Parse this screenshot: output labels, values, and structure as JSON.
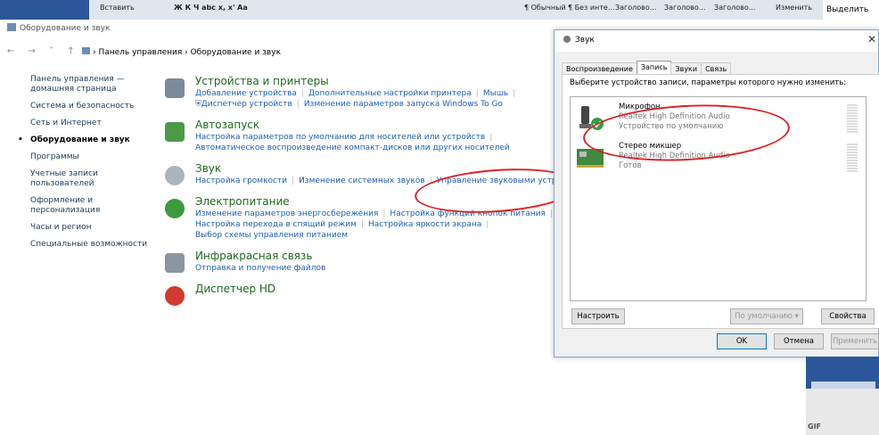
{
  "ribbon": {
    "insert": "Вставить",
    "format": "Ж  К  Ч  abc  x,  x'  Aa",
    "styles": [
      "¶ Обычный",
      "¶ Без инте...",
      "Заголово...",
      "Заголово...",
      "Заголово..."
    ],
    "change": "Изменить",
    "select": "Выделить"
  },
  "control_panel": {
    "window_title": "Оборудование и звук",
    "address": {
      "nav": "←  →  ˅  ↑",
      "breadcrumb": "›  Панель управления  ›  Оборудование и звук"
    },
    "left_nav": [
      {
        "label": "Панель управления — домашняя страница"
      },
      {
        "label": "Система и безопасность"
      },
      {
        "label": "Сеть и Интернет"
      },
      {
        "label": "Оборудование и звук"
      },
      {
        "label": "Программы"
      },
      {
        "label": "Учетные записи пользователей"
      },
      {
        "label": "Оформление и персонализация"
      },
      {
        "label": "Часы и регион"
      },
      {
        "label": "Специальные возможности"
      }
    ],
    "categories": [
      {
        "title": "Устройства и принтеры",
        "links": [
          "Добавление устройства",
          "Дополнительные настройки принтера",
          "Мышь",
          "Диспетчер устройств",
          "Изменение параметров запуска Windows To Go"
        ]
      },
      {
        "title": "Автозапуск",
        "links": [
          "Настройка параметров по умолчанию для носителей или устройств",
          "Автоматическое воспроизведение компакт-дисков или других носителей"
        ]
      },
      {
        "title": "Звук",
        "links": [
          "Настройка громкости",
          "Изменение системных звуков",
          "Управление звуковыми устройс"
        ]
      },
      {
        "title": "Электропитание",
        "links": [
          "Изменение параметров энергосбережения",
          "Настройка функций кнопок питания",
          "Настройка перехода в спящий режим",
          "Настройка яркости экрана",
          "Выбор схемы управления питанием"
        ]
      },
      {
        "title": "Инфракрасная связь",
        "links": [
          "Отправка и получение файлов"
        ]
      },
      {
        "title": "Диспетчер HD",
        "links": []
      }
    ]
  },
  "sound_dialog": {
    "title": "Звук",
    "close": "✕",
    "tabs": [
      "Воспроизведение",
      "Запись",
      "Звуки",
      "Связь"
    ],
    "active_tab": "Запись",
    "instruction": "Выберите устройство записи, параметры которого нужно изменить:",
    "devices": [
      {
        "name": "Микрофон",
        "driver": "Realtek High Definition Audio",
        "status": "Устройство по умолчанию"
      },
      {
        "name": "Стерео микшер",
        "driver": "Realtek High Definition Audio",
        "status": "Готов"
      }
    ],
    "buttons": {
      "configure": "Настроить",
      "set_default": "По умолчанию",
      "properties": "Свойства",
      "ok": "OK",
      "cancel": "Отмена",
      "apply": "Применить"
    }
  },
  "misc": {
    "gif_label": "GIF"
  },
  "colors": {
    "link": "#1a5fb4",
    "category_title": "#1e6a1e",
    "annotation": "#dd2222",
    "check_green": "#2ea043"
  }
}
